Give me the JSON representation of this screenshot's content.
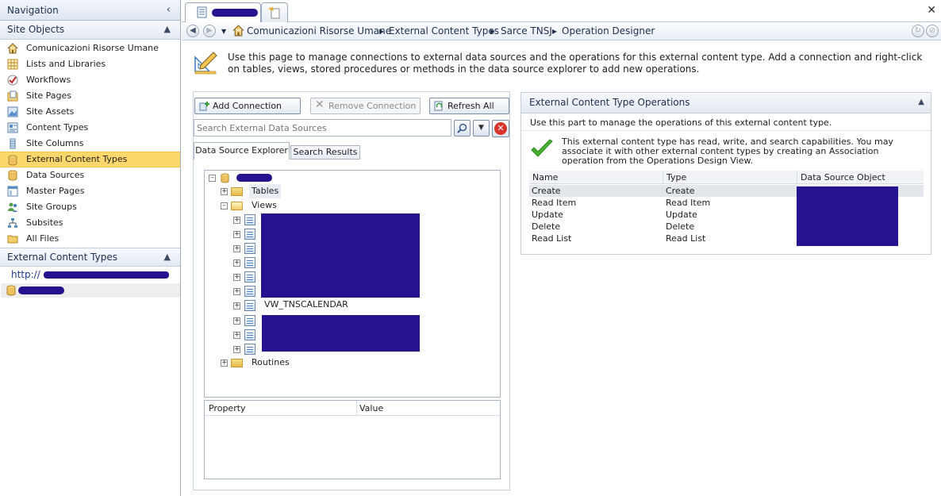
{
  "nav": {
    "title": "Navigation",
    "site_objects_header": "Site Objects",
    "items": [
      {
        "label": "Comunicazioni Risorse Umane",
        "icon": "home-icon"
      },
      {
        "label": "Lists and Libraries",
        "icon": "list-icon"
      },
      {
        "label": "Workflows",
        "icon": "workflow-icon"
      },
      {
        "label": "Site Pages",
        "icon": "page-folder-icon"
      },
      {
        "label": "Site Assets",
        "icon": "assets-icon"
      },
      {
        "label": "Content Types",
        "icon": "content-types-icon"
      },
      {
        "label": "Site Columns",
        "icon": "column-icon"
      },
      {
        "label": "External Content Types",
        "icon": "database-icon",
        "selected": true
      },
      {
        "label": "Data Sources",
        "icon": "database-icon"
      },
      {
        "label": "Master Pages",
        "icon": "master-page-icon"
      },
      {
        "label": "Site Groups",
        "icon": "groups-icon"
      },
      {
        "label": "Subsites",
        "icon": "subsites-icon"
      },
      {
        "label": "All Files",
        "icon": "folder-icon"
      }
    ],
    "ect_header": "External Content Types",
    "ect_url_prefix": "http://"
  },
  "breadcrumb": [
    "Comunicazioni Risorse Umane",
    "External Content Types",
    "Sarce TNSJ",
    "Operation Designer"
  ],
  "intro_text": "Use this page to manage connections to external data sources and the operations for this external content type. Add a connection and right-click on tables, views, stored procedures or methods in the data source explorer to add new operations.",
  "toolbar": {
    "add_connection": "Add Connection",
    "remove_connection": "Remove Connection",
    "refresh_all": "Refresh All"
  },
  "search": {
    "placeholder": "Search External Data Sources"
  },
  "explorer_tabs": [
    "Data Source Explorer",
    "Search Results"
  ],
  "tree": {
    "tables": "Tables",
    "views": "Views",
    "view_item": "VW_TNSCALENDAR",
    "routines": "Routines"
  },
  "property_grid": {
    "col_property": "Property",
    "col_value": "Value"
  },
  "operations": {
    "title": "External Content Type Operations",
    "description": "Use this part to manage the operations of this external content type.",
    "status": "This external content type has read, write, and search capabilities. You may associate it with other external content types by creating an Association operation from the Operations Design View.",
    "columns": [
      "Name",
      "Type",
      "Data Source Object"
    ],
    "rows": [
      {
        "name": "Create",
        "type": "Create"
      },
      {
        "name": "Read Item",
        "type": "Read Item"
      },
      {
        "name": "Update",
        "type": "Update"
      },
      {
        "name": "Delete",
        "type": "Delete"
      },
      {
        "name": "Read List",
        "type": "Read List"
      }
    ]
  },
  "colors": {
    "selection": "#fcd86c",
    "redaction": "#24128f",
    "accent": "#1e2f4e"
  }
}
